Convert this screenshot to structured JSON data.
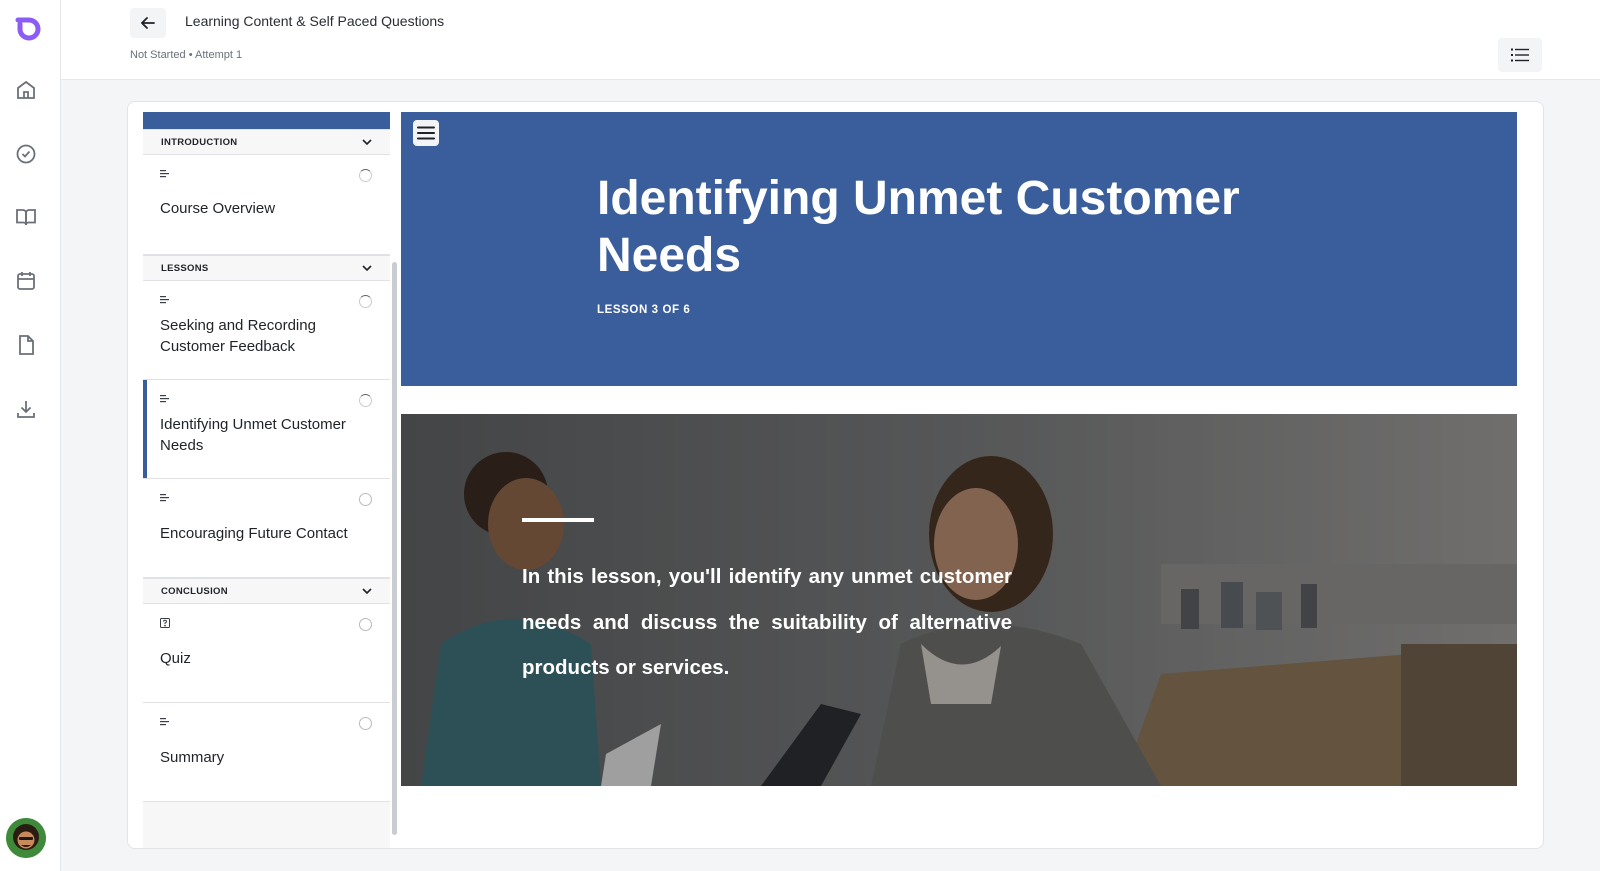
{
  "header": {
    "course_title": "Learning Content & Self Paced Questions",
    "status_line": "Not Started • Attempt 1"
  },
  "rail": {
    "icons": [
      "home-icon",
      "badge-check-icon",
      "book-icon",
      "calendar-icon",
      "document-icon",
      "download-icon"
    ]
  },
  "outline": {
    "sections": [
      {
        "label": "INTRODUCTION",
        "items": [
          {
            "title": "Course Overview",
            "type": "text-lesson",
            "status": "in-progress"
          }
        ]
      },
      {
        "label": "LESSONS",
        "items": [
          {
            "title": "Seeking and Recording Customer Feedback",
            "type": "text-lesson",
            "status": "in-progress"
          },
          {
            "title": "Identifying Unmet Customer Needs",
            "type": "text-lesson",
            "status": "in-progress",
            "active": true
          },
          {
            "title": "Encouraging Future Contact",
            "type": "text-lesson",
            "status": "not-started"
          }
        ]
      },
      {
        "label": "CONCLUSION",
        "items": [
          {
            "title": "Quiz",
            "type": "quiz",
            "status": "not-started"
          },
          {
            "title": "Summary",
            "type": "text-lesson",
            "status": "not-started"
          }
        ]
      }
    ]
  },
  "lesson": {
    "title": "Identifying Unmet Customer Needs",
    "counter": "LESSON 3 OF 6",
    "intro": "In this lesson, you'll identify any unmet customer needs and discuss the suitability of alternative products or services."
  },
  "colors": {
    "accent": "#3a5e9c",
    "logo": "#8b5cf6"
  }
}
